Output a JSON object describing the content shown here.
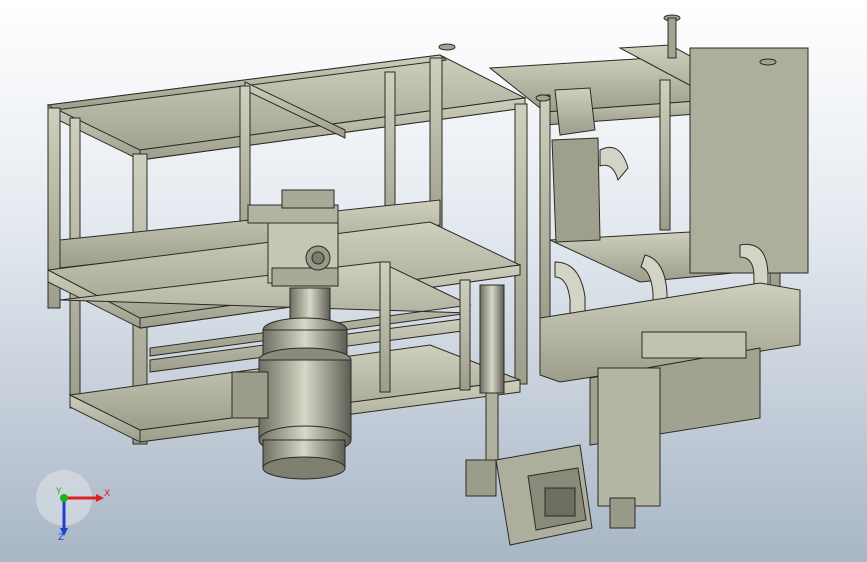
{
  "viewport": {
    "background_top": "#ffffff",
    "background_bottom": "#a8b6c6",
    "model_color": "#b9b9a7",
    "model_shadow": "#8f8f7e",
    "edge_color": "#2b2b25"
  },
  "triad": {
    "x_label": "X",
    "y_label": "Y",
    "z_label": "Z",
    "x_color": "#e02020",
    "y_color": "#20b020",
    "z_color": "#2040d0"
  }
}
